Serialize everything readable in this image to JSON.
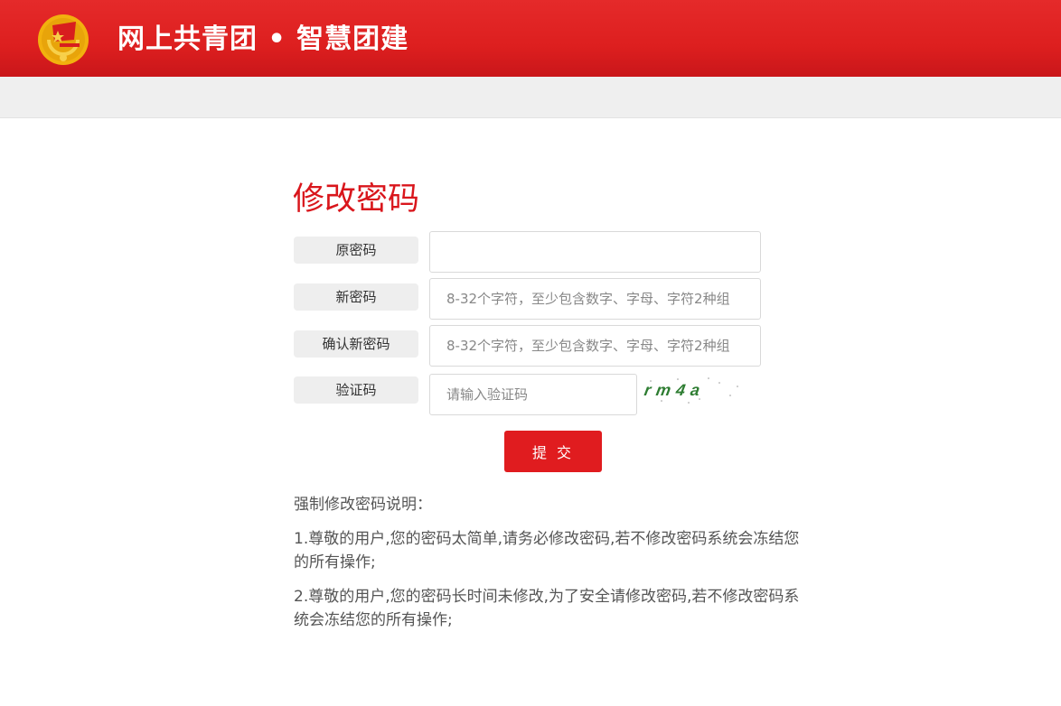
{
  "header": {
    "site_title": "网上共青团 • 智慧团建",
    "brand_color": "#dd1f1f",
    "logo_icon": "communist-youth-league-emblem-icon"
  },
  "form": {
    "title": "修改密码",
    "old_password": {
      "label": "原密码",
      "value": "",
      "placeholder": ""
    },
    "new_password": {
      "label": "新密码",
      "placeholder": "8-32个字符，至少包含数字、字母、字符2种组"
    },
    "confirm_password": {
      "label": "确认新密码",
      "placeholder": "8-32个字符，至少包含数字、字母、字符2种组"
    },
    "captcha": {
      "label": "验证码",
      "placeholder": "请输入验证码",
      "image_text": "rm4a"
    },
    "submit_label": "提 交"
  },
  "notes": {
    "heading": "强制修改密码说明：",
    "items": [
      "1.尊敬的用户,您的密码太简单,请务必修改密码,若不修改密码系统会冻结您的所有操作;",
      "2.尊敬的用户,您的密码长时间未修改,为了安全请修改密码,若不修改密码系统会冻结您的所有操作;"
    ]
  }
}
